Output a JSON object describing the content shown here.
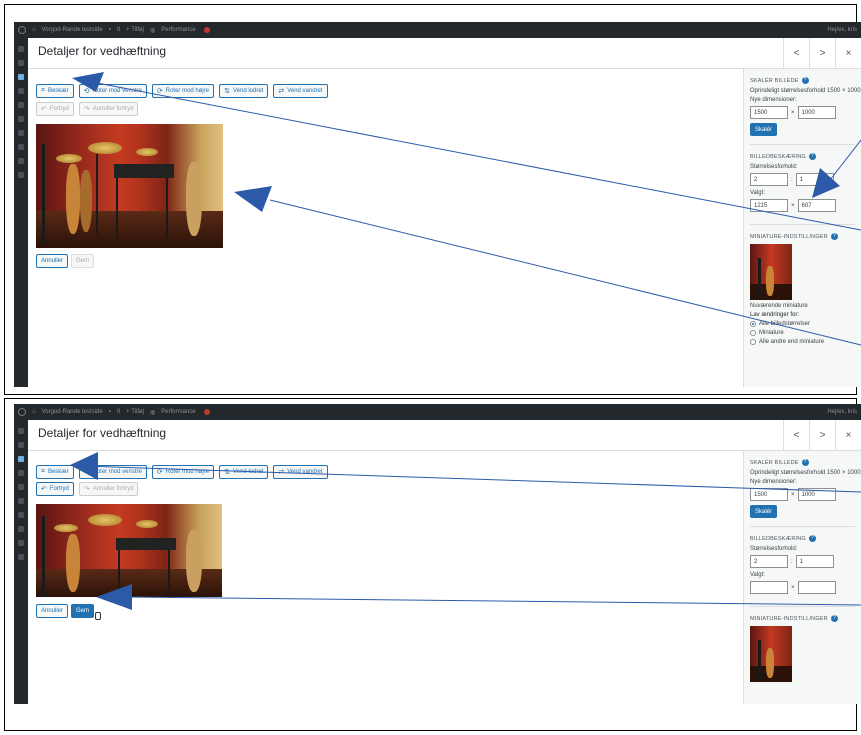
{
  "wp_adminbar": {
    "site_name": "Vorgod-Rande testside",
    "comments_count": "0",
    "new_label": "+ Tilføj",
    "performance_label": "Performance",
    "howdy_top": "Hej/ex, kris",
    "howdy_bottom": "Hej/ex, kris"
  },
  "modal": {
    "title": "Detaljer for vedhæftning",
    "nav_prev": "<",
    "nav_next": ">",
    "nav_close": "×"
  },
  "toolbar": {
    "crop": "Beskær",
    "rotate_left": "Roter mod venstre",
    "rotate_right": "Roter mod højre",
    "flip_vertical": "Vend lodret",
    "flip_horizontal": "Vend vandret",
    "undo": "Fortryd",
    "redo": "Annuller fortryd"
  },
  "footer": {
    "cancel": "Annuller",
    "save": "Gem"
  },
  "sidebar": {
    "scale_heading": "SKALÉR BILLEDE",
    "original_size_top": "Oprindeligt størrelsesforhold 1500 × 1000",
    "original_size_bottom": "Oprindeligt størrelsesforhold 1500 × 1000",
    "new_dimensions": "Nye dimensioner:",
    "width": "1500",
    "height": "1000",
    "times": "×",
    "scale_btn": "Skalér",
    "crop_heading": "BILLEDBESKÆRING",
    "aspect_label": "Størrelsesforhold:",
    "aspect_w": "2",
    "aspect_h": "1",
    "colon": ":",
    "selection_label": "Valgt:",
    "sel_w": "1215",
    "sel_h": "607",
    "thumb_heading": "MINIATURE-INDSTILLINGER",
    "current_thumb": "Nuværende miniature",
    "apply_changes": "Lav ændringer for:",
    "opt_all": "Alle billedstørrelser",
    "opt_thumb": "Miniature",
    "opt_others": "Alle andre end miniature"
  },
  "colors": {
    "wp_blue": "#2271b1",
    "admin_dark": "#23282d",
    "arrow_blue": "#2c5aa8"
  },
  "icons": {
    "crop": "crop-icon",
    "rotate_left": "rotate-left-icon",
    "rotate_right": "rotate-right-icon",
    "flip_vertical": "flip-vertical-icon",
    "flip_horizontal": "flip-horizontal-icon",
    "undo": "undo-icon",
    "redo": "redo-icon",
    "help": "help-icon",
    "cursor": "hand-cursor-icon"
  }
}
